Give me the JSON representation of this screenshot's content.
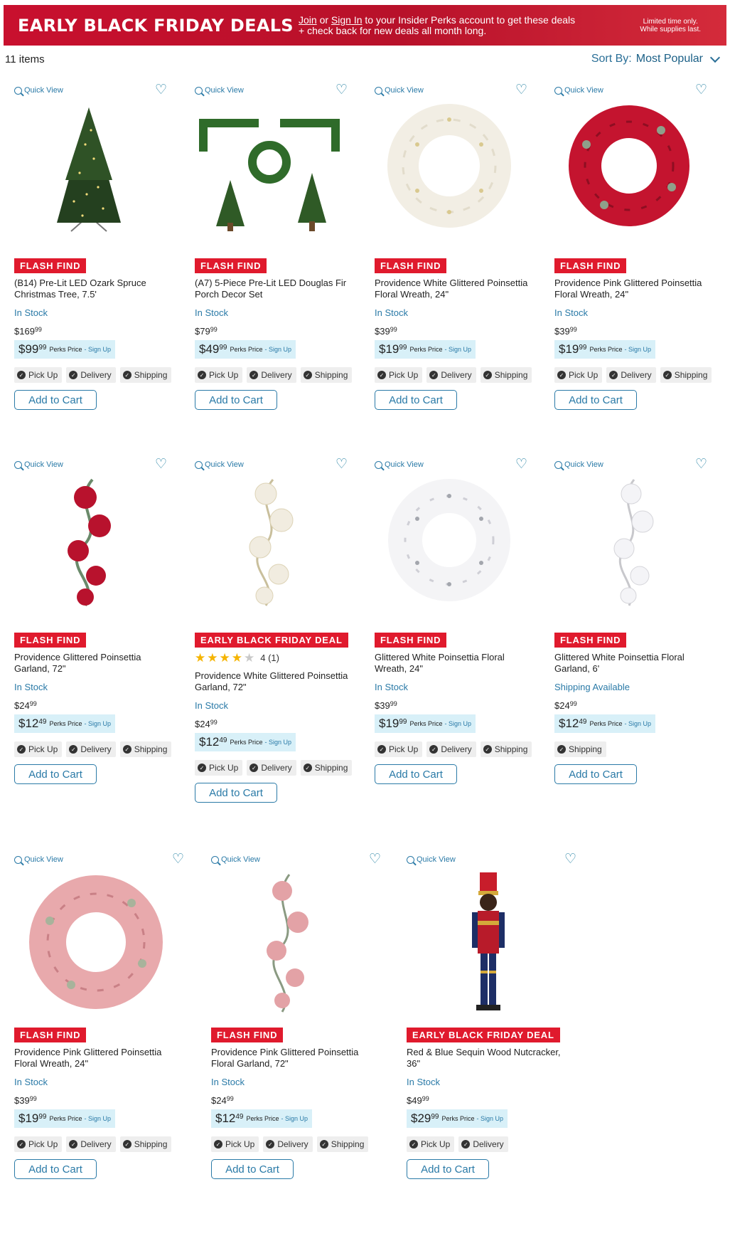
{
  "banner": {
    "title": "EARLY BLACK FRIDAY DEALS",
    "join": "Join",
    "or": " or ",
    "signin": "Sign In",
    "line1_rest": " to your Insider Perks account to get these deals",
    "line2": "+ check back for new deals all month long.",
    "limited1": "Limited time only.",
    "limited2": "While supplies last."
  },
  "results": {
    "count": "11 items",
    "sort_label": "Sort By:",
    "sort_value": "Most Popular"
  },
  "common": {
    "quick_view": "Quick View",
    "perks_label": "Perks Price",
    "sign_up": "- Sign Up",
    "add_to_cart": "Add to Cart",
    "pickup": "Pick Up",
    "delivery": "Delivery",
    "shipping": "Shipping"
  },
  "products": [
    {
      "badge": "FLASH FIND",
      "name": "(B14) Pre-Lit LED Ozark Spruce Christmas Tree, 7.5'",
      "stock": "In Stock",
      "price_d": "$169",
      "price_c": "99",
      "perks_d": "$99",
      "perks_c": "99",
      "fulfillment": [
        "Pick Up",
        "Delivery",
        "Shipping"
      ]
    },
    {
      "badge": "FLASH FIND",
      "name": "(A7) 5-Piece Pre-Lit LED Douglas Fir Porch Decor Set",
      "stock": "In Stock",
      "price_d": "$79",
      "price_c": "99",
      "perks_d": "$49",
      "perks_c": "99",
      "fulfillment": [
        "Pick Up",
        "Delivery",
        "Shipping"
      ]
    },
    {
      "badge": "FLASH FIND",
      "name": "Providence White Glittered Poinsettia Floral Wreath, 24\"",
      "stock": "In Stock",
      "price_d": "$39",
      "price_c": "99",
      "perks_d": "$19",
      "perks_c": "99",
      "fulfillment": [
        "Pick Up",
        "Delivery",
        "Shipping"
      ]
    },
    {
      "badge": "FLASH FIND",
      "name": "Providence Pink Glittered Poinsettia Floral Wreath, 24\"",
      "stock": "In Stock",
      "price_d": "$39",
      "price_c": "99",
      "perks_d": "$19",
      "perks_c": "99",
      "fulfillment": [
        "Pick Up",
        "Delivery",
        "Shipping"
      ]
    },
    {
      "badge": "FLASH FIND",
      "name": "Providence Glittered Poinsettia Garland, 72\"",
      "stock": "In Stock",
      "price_d": "$24",
      "price_c": "99",
      "perks_d": "$12",
      "perks_c": "49",
      "fulfillment": [
        "Pick Up",
        "Delivery",
        "Shipping"
      ]
    },
    {
      "badge": "EARLY BLACK FRIDAY DEAL",
      "rating_text": "4 (1)",
      "rating": 4,
      "name": "Providence White Glittered Poinsettia Garland, 72\"",
      "stock": "In Stock",
      "price_d": "$24",
      "price_c": "99",
      "perks_d": "$12",
      "perks_c": "49",
      "fulfillment": [
        "Pick Up",
        "Delivery",
        "Shipping"
      ]
    },
    {
      "badge": "FLASH FIND",
      "name": "Glittered White Poinsettia Floral Wreath, 24\"",
      "stock": "In Stock",
      "price_d": "$39",
      "price_c": "99",
      "perks_d": "$19",
      "perks_c": "99",
      "fulfillment": [
        "Pick Up",
        "Delivery",
        "Shipping"
      ]
    },
    {
      "badge": "FLASH FIND",
      "name": "Glittered White Poinsettia Floral Garland, 6'",
      "stock": "Shipping Available",
      "price_d": "$24",
      "price_c": "99",
      "perks_d": "$12",
      "perks_c": "49",
      "fulfillment": [
        "Shipping"
      ]
    },
    {
      "badge": "FLASH FIND",
      "name": "Providence Pink Glittered Poinsettia Floral Wreath, 24\"",
      "stock": "In Stock",
      "price_d": "$39",
      "price_c": "99",
      "perks_d": "$19",
      "perks_c": "99",
      "fulfillment": [
        "Pick Up",
        "Delivery",
        "Shipping"
      ]
    },
    {
      "badge": "FLASH FIND",
      "name": "Providence Pink Glittered Poinsettia Floral Garland, 72\"",
      "stock": "In Stock",
      "price_d": "$24",
      "price_c": "99",
      "perks_d": "$12",
      "perks_c": "49",
      "fulfillment": [
        "Pick Up",
        "Delivery",
        "Shipping"
      ]
    },
    {
      "badge": "EARLY BLACK FRIDAY DEAL",
      "name": "Red & Blue Sequin Wood Nutcracker, 36\"",
      "stock": "In Stock",
      "price_d": "$49",
      "price_c": "99",
      "perks_d": "$29",
      "perks_c": "99",
      "fulfillment": [
        "Pick Up",
        "Delivery"
      ]
    }
  ],
  "colors": {
    "banner": "#c8102e",
    "badge": "#e01a2d",
    "link": "#2a7aa7",
    "perks_bg": "#d8f0f8"
  }
}
